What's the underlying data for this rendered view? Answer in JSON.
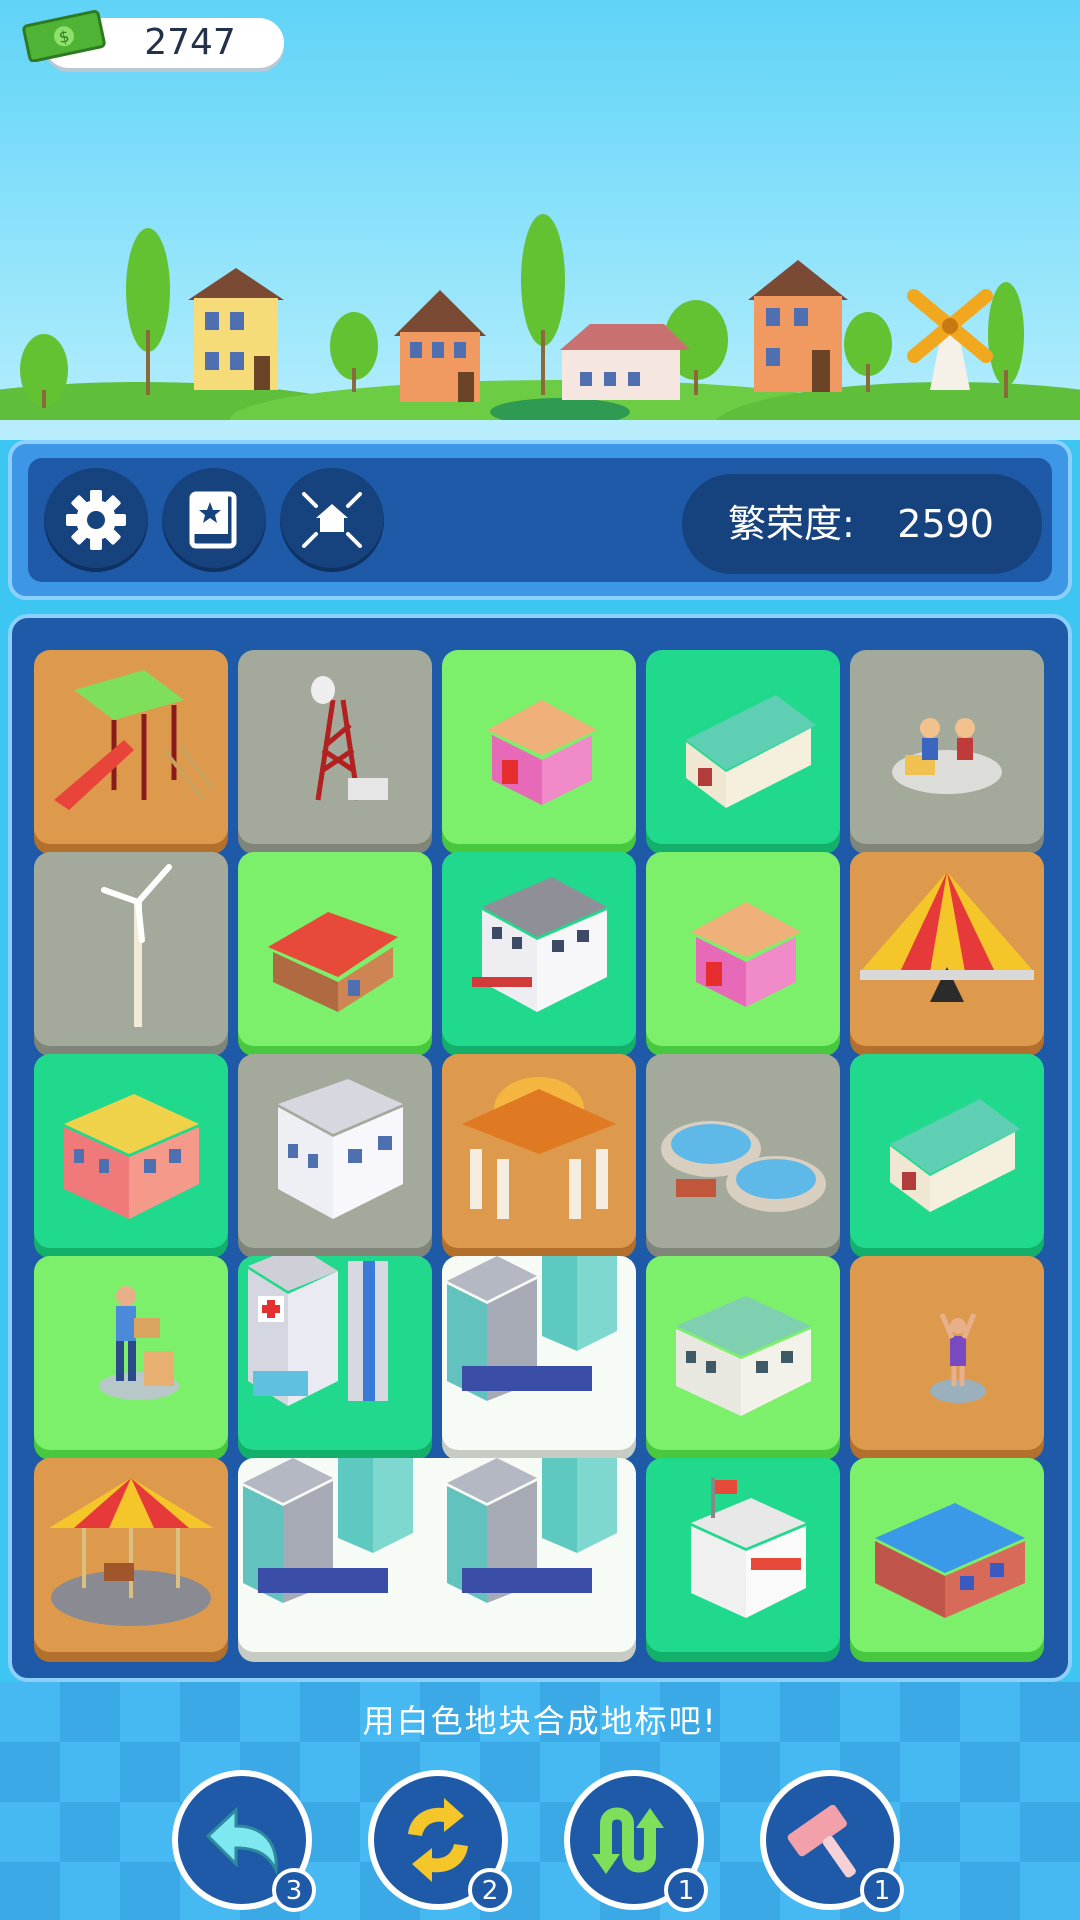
{
  "header": {
    "money_value": "2747",
    "money_icon": "cash-icon"
  },
  "toolbar": {
    "buttons": [
      {
        "name": "settings-button",
        "icon": "gear-icon"
      },
      {
        "name": "collection-button",
        "icon": "book-star-icon"
      },
      {
        "name": "merge-home-button",
        "icon": "house-collapse-icon"
      }
    ],
    "prosperity_label": "繁荣度:",
    "prosperity_value": "2590"
  },
  "board": {
    "rows": [
      [
        "playground-slide",
        "radio-tower",
        "pink-cottage",
        "warehouse",
        "street-performers"
      ],
      [
        "wind-turbine",
        "red-roof-house",
        "apartment-block",
        "pink-cottage",
        "circus-tent"
      ],
      [
        "shop-building",
        "factory",
        "domed-landmark",
        "water-tanks",
        "warehouse"
      ],
      [
        "delivery-person",
        "hospital",
        "office-towers",
        "town-hall",
        "dancer"
      ],
      [
        "carousel",
        "office-towers",
        "office-towers",
        "post-office",
        "blue-mall"
      ]
    ],
    "colors": [
      [
        "orange",
        "gray",
        "lime",
        "teal",
        "gray"
      ],
      [
        "gray",
        "lime",
        "teal",
        "lime",
        "orange"
      ],
      [
        "teal",
        "gray",
        "orange",
        "gray",
        "teal"
      ],
      [
        "lime",
        "teal",
        "white",
        "lime",
        "orange"
      ],
      [
        "orange",
        "white",
        "white",
        "teal",
        "lime"
      ]
    ]
  },
  "hint_text": "用白色地块合成地标吧!",
  "tools": [
    {
      "icon": "undo-icon",
      "count": "3"
    },
    {
      "icon": "shuffle-icon",
      "count": "2"
    },
    {
      "icon": "swap-icon",
      "count": "1"
    },
    {
      "icon": "hammer-icon",
      "count": "1"
    }
  ],
  "colors": {
    "panel": "#1e5aa7",
    "tile_orange": "#dd9a4c",
    "tile_gray": "#a3a99b",
    "tile_lime": "#7cef6b",
    "tile_teal": "#21d98c",
    "tile_white": "#f7fbf6"
  }
}
